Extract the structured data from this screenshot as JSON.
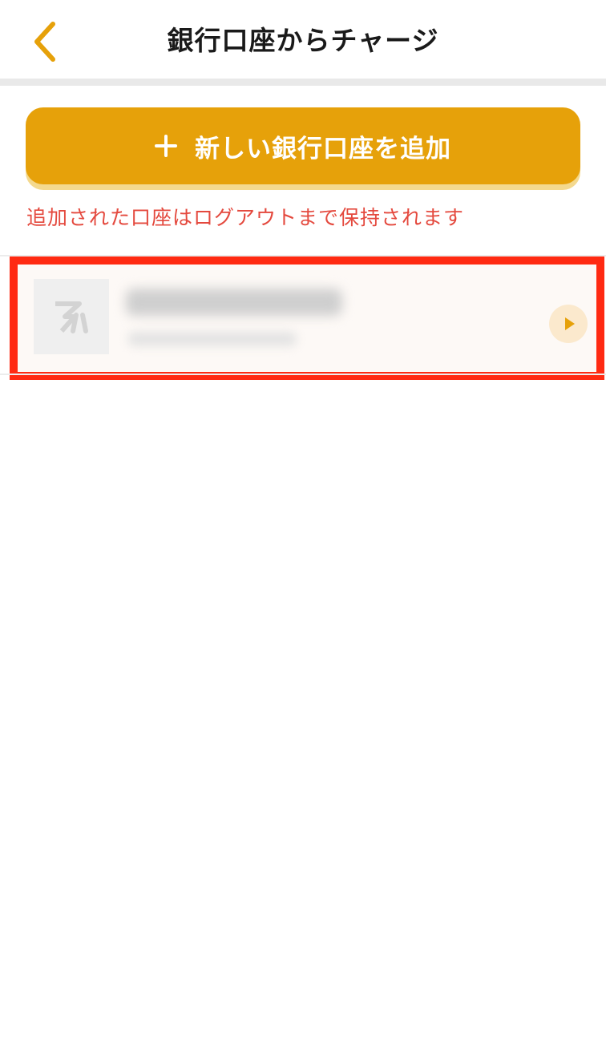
{
  "header": {
    "title": "銀行口座からチャージ",
    "back_icon": "chevron-left-icon"
  },
  "add_account": {
    "label": "新しい銀行口座を追加",
    "icon": "plus-icon"
  },
  "notice": "追加された口座はログアウトまで保持されます",
  "accounts": [
    {
      "logo_icon": "bank-logo-icon",
      "chevron_icon": "play-arrow-icon"
    }
  ],
  "colors": {
    "accent": "#e6a10a",
    "accent_shadow": "#f4d98e",
    "notice_red": "#e4493e",
    "highlight_red": "#ff2a12",
    "title_text": "#1a1a1a",
    "divider": "#e9e9e9"
  }
}
